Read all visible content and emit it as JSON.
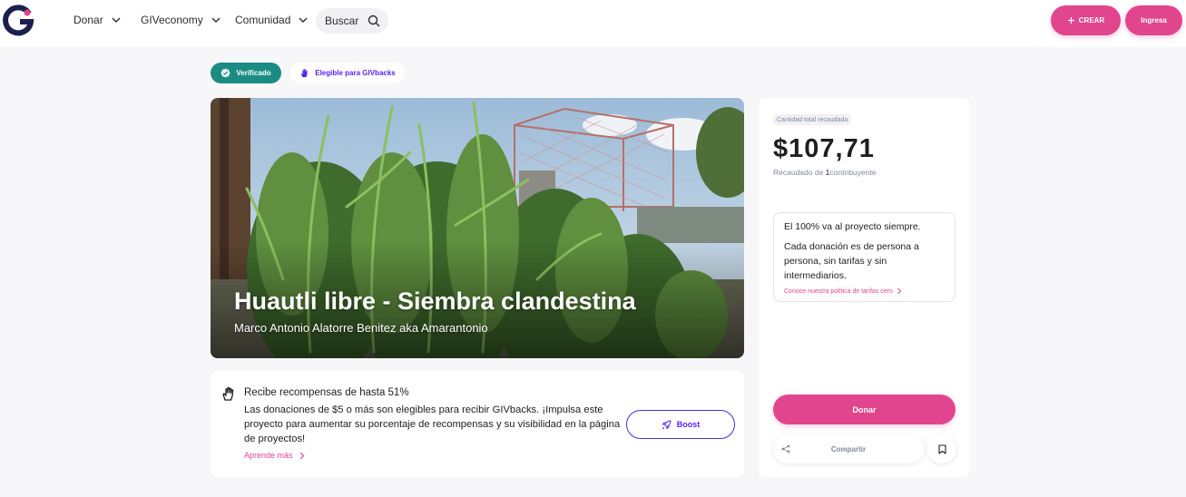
{
  "header": {
    "logo_icon": "giveth-logo-icon",
    "nav": [
      {
        "label": "Donar"
      },
      {
        "label": "GIVeconomy"
      },
      {
        "label": "Comunidad"
      }
    ],
    "search_label": "Buscar",
    "create_label": "CREAR",
    "signin_label": "Ingresa"
  },
  "badges": {
    "verified": "Verificado",
    "givbacks": "Elegible para GIVbacks"
  },
  "project": {
    "title": "Huautli libre - Siembra clandestina",
    "author": "Marco Antonio Alatorre Benitez aka Amarantonio"
  },
  "rewards": {
    "title": "Recibe recompensas de hasta 51%",
    "body": "Las donaciones de $5 o más son elegibles para recibir GIVbacks. ¡Impulsa este proyecto para aumentar su porcentaje de recompensas y su visibilidad en la página de proyectos!",
    "learn_more": "Aprende más",
    "boost_label": "Boost"
  },
  "panel": {
    "total_label": "Cantidad total recaudada",
    "amount": "$107,71",
    "raised_prefix": "Recaudado de",
    "contributors": "1",
    "raised_suffix": "contribuyente",
    "fee_title": "El 100% va al proyecto siempre.",
    "fee_body": "Cada donación es de persona a persona, sin tarifas y sin intermediarios.",
    "fee_link": "Conoce nuestra política de tarifas cero",
    "donate_label": "Donar",
    "share_label": "Compartir"
  },
  "colors": {
    "brand_pink": "#e1458d",
    "brand_purple": "#5326ec",
    "verified_teal": "#1b8c82",
    "logo_navy": "#1b1f4e"
  }
}
